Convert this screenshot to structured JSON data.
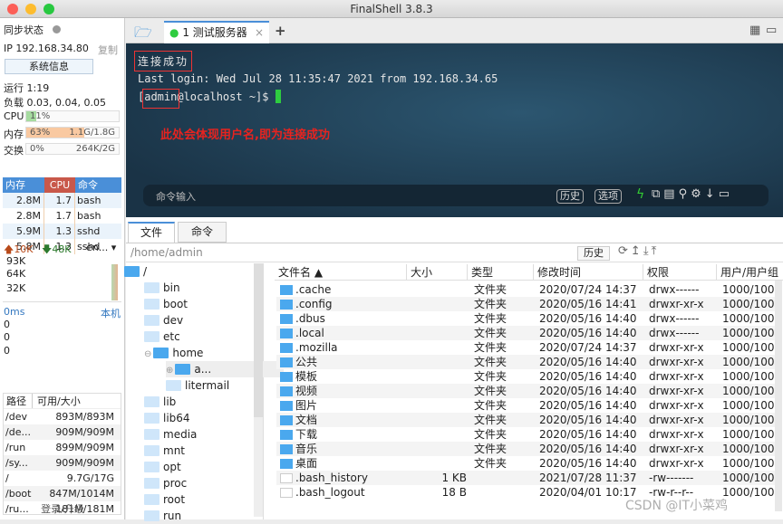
{
  "window": {
    "title": "FinalShell 3.8.3"
  },
  "left": {
    "sync_label": "同步状态",
    "ip": "IP 192.168.34.80",
    "copy": "复制",
    "sysinfo": "系统信息",
    "uptime": "运行 1:19",
    "load": "负载 0.03, 0.04, 0.05",
    "cpu": {
      "label": "CPU",
      "text": "11%",
      "percent": 11
    },
    "mem": {
      "label": "内存",
      "text": "63%",
      "value": "1.1G/1.8G",
      "percent": 63
    },
    "swap": {
      "label": "交换",
      "text": "0%",
      "value": "264K/2G",
      "percent": 0
    },
    "proc_headers": [
      "内存",
      "CPU",
      "命令"
    ],
    "procs": [
      [
        "2.8M",
        "1.7",
        "bash"
      ],
      [
        "2.8M",
        "1.7",
        "bash"
      ],
      [
        "5.9M",
        "1.3",
        "sshd"
      ],
      [
        "5.8M",
        "1.3",
        "sshd"
      ]
    ],
    "net": {
      "up": "10K",
      "down": "48K",
      "iface": "en...",
      "ticks": [
        "93K",
        "64K",
        "32K"
      ]
    },
    "ping": {
      "ms": "0ms",
      "host": "本机",
      "ticks": [
        "0",
        "0",
        "0"
      ]
    },
    "disk_headers": [
      "路径",
      "可用/大小"
    ],
    "disks": [
      [
        "/dev",
        "893M/893M"
      ],
      [
        "/de...",
        "909M/909M"
      ],
      [
        "/run",
        "899M/909M"
      ],
      [
        "/sy...",
        "909M/909M"
      ],
      [
        "/",
        "9.7G/17G"
      ],
      [
        "/boot",
        "847M/1014M"
      ],
      [
        "/ru...",
        "181M/181M"
      ]
    ],
    "login": "登录/升级"
  },
  "tabs": {
    "active": "1 测试服务器"
  },
  "terminal": {
    "lines": [
      "连接成功",
      "Last login: Wed Jul 28 11:35:47 2021 from 192.168.34.65",
      "[admin@localhost ~]$ "
    ],
    "annotation": "此处会体现用户名,即为连接成功",
    "cmd_placeholder": "命令输入",
    "history": "历史",
    "options": "选项"
  },
  "colors": {
    "accent": "#4a8fd8",
    "annotation": "#e8231f",
    "cursor": "#2ecc40"
  },
  "files": {
    "tabs": [
      "文件",
      "命令"
    ],
    "path": "/home/admin",
    "history": "历史",
    "tree": [
      [
        "/",
        0,
        1
      ],
      [
        "bin",
        1,
        0
      ],
      [
        "boot",
        1,
        0
      ],
      [
        "dev",
        1,
        0
      ],
      [
        "etc",
        1,
        0
      ],
      [
        "home",
        1,
        1
      ],
      [
        "a...",
        2,
        1
      ],
      [
        "litermail",
        2,
        0
      ],
      [
        "lib",
        1,
        0
      ],
      [
        "lib64",
        1,
        0
      ],
      [
        "media",
        1,
        0
      ],
      [
        "mnt",
        1,
        0
      ],
      [
        "opt",
        1,
        0
      ],
      [
        "proc",
        1,
        0
      ],
      [
        "root",
        1,
        0
      ],
      [
        "run",
        1,
        0
      ]
    ],
    "headers": [
      "文件名 ▲",
      "大小",
      "类型",
      "修改时间",
      "权限",
      "用户/用户组"
    ],
    "rows": [
      [
        ".cache",
        "",
        "文件夹",
        "2020/07/24 14:37",
        "drwx------",
        "1000/100"
      ],
      [
        ".config",
        "",
        "文件夹",
        "2020/05/16 14:41",
        "drwxr-xr-x",
        "1000/100"
      ],
      [
        ".dbus",
        "",
        "文件夹",
        "2020/05/16 14:40",
        "drwx------",
        "1000/100"
      ],
      [
        ".local",
        "",
        "文件夹",
        "2020/05/16 14:40",
        "drwx------",
        "1000/100"
      ],
      [
        ".mozilla",
        "",
        "文件夹",
        "2020/07/24 14:37",
        "drwxr-xr-x",
        "1000/100"
      ],
      [
        "公共",
        "",
        "文件夹",
        "2020/05/16 14:40",
        "drwxr-xr-x",
        "1000/100"
      ],
      [
        "模板",
        "",
        "文件夹",
        "2020/05/16 14:40",
        "drwxr-xr-x",
        "1000/100"
      ],
      [
        "视频",
        "",
        "文件夹",
        "2020/05/16 14:40",
        "drwxr-xr-x",
        "1000/100"
      ],
      [
        "图片",
        "",
        "文件夹",
        "2020/05/16 14:40",
        "drwxr-xr-x",
        "1000/100"
      ],
      [
        "文档",
        "",
        "文件夹",
        "2020/05/16 14:40",
        "drwxr-xr-x",
        "1000/100"
      ],
      [
        "下载",
        "",
        "文件夹",
        "2020/05/16 14:40",
        "drwxr-xr-x",
        "1000/100"
      ],
      [
        "音乐",
        "",
        "文件夹",
        "2020/05/16 14:40",
        "drwxr-xr-x",
        "1000/100"
      ],
      [
        "桌面",
        "",
        "文件夹",
        "2020/05/16 14:40",
        "drwxr-xr-x",
        "1000/100"
      ],
      [
        ".bash_history",
        "1 KB",
        "",
        "2021/07/28 11:37",
        "-rw-------",
        "1000/100"
      ],
      [
        ".bash_logout",
        "18 B",
        "",
        "2020/04/01 10:17",
        "-rw-r--r--",
        "1000/100"
      ]
    ]
  },
  "watermark": "CSDN @IT小菜鸡"
}
